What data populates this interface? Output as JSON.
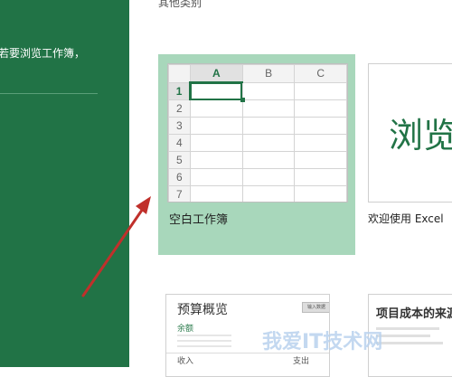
{
  "left_panel": {
    "hint": "若要浏览工作簿，"
  },
  "main": {
    "category_label": "其他类别",
    "blank_workbook": {
      "label": "空白工作簿",
      "col_headers": [
        "A",
        "B",
        "C"
      ],
      "row_headers": [
        "1",
        "2",
        "3",
        "4",
        "5",
        "6",
        "7"
      ]
    },
    "welcome_template": {
      "preview_text": "浏览",
      "label": "欢迎使用 Excel"
    },
    "budget_template": {
      "title": "预算概览",
      "button": "输入数据",
      "section": "余额",
      "income": "收入",
      "expense": "支出"
    },
    "project_template": {
      "title": "项目成本的来源"
    }
  },
  "watermark": "我爱IT技术网",
  "colors": {
    "excel_green": "#217346",
    "selected_tile": "#a8d7bb",
    "arrow": "#c0302b"
  },
  "icons": [
    "arrow-annotation"
  ]
}
